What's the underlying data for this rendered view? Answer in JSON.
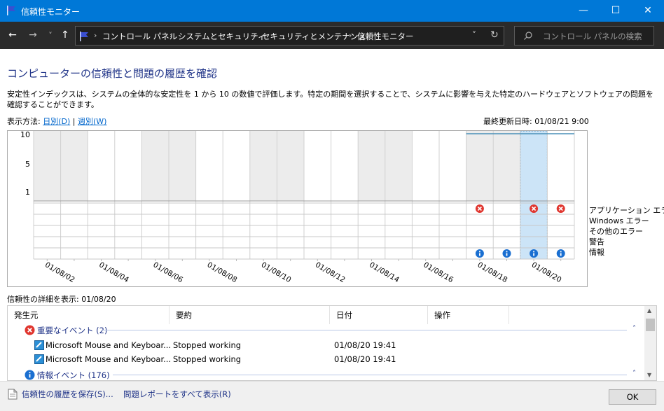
{
  "window": {
    "title": "信頼性モニター",
    "controls": {
      "minimize": "—",
      "maximize": "☐",
      "close": "✕"
    }
  },
  "address_bar": {
    "nav": {
      "back": "←",
      "forward": "→",
      "recent": "˅",
      "up": "↑"
    },
    "breadcrumbs": [
      "コントロール パネル",
      "システムとセキュリティ",
      "セキュリティとメンテナンス",
      "信頼性モニター"
    ],
    "separator": "›",
    "dropdown": "˅",
    "refresh": "↻",
    "search_placeholder": "コントロール パネルの検索"
  },
  "page": {
    "heading": "コンピューターの信頼性と問題の履歴を確認",
    "description": "安定性インデックスは、システムの全体的な安定性を 1 から 10 の数値で評価します。特定の期間を選択することで、システムに影響を与えた特定のハードウェアとソフトウェアの問題を確認することができます。",
    "view_by_label": "表示方法:",
    "view_days": "日別(D)",
    "view_separator": "|",
    "view_weeks": "週別(W)",
    "last_updated": "最終更新日時: 01/08/21 9:00"
  },
  "chart_data": {
    "type": "table",
    "y_axis_labels": [
      "10",
      "5",
      "1"
    ],
    "column_count": 20,
    "date_labels": [
      "01/08/02",
      "01/08/04",
      "01/08/06",
      "01/08/08",
      "01/08/10",
      "01/08/12",
      "01/08/14",
      "01/08/16",
      "01/08/18",
      "01/08/20"
    ],
    "selected_date": "01/08/20",
    "rows": [
      "アプリケーション エラー",
      "Windows エラー",
      "その他のエラー",
      "警告",
      "情報"
    ],
    "stability_index_visible_from_column": 16,
    "stability_index_value": 10,
    "application_error_columns": [
      16,
      18,
      19
    ],
    "information_columns": [
      16,
      17,
      18,
      19
    ],
    "selected_column": 18,
    "error_icon": "error-x-icon",
    "info_icon": "info-i-icon",
    "line_color": "#4a90b8",
    "selected_color": "#cce4f7"
  },
  "details": {
    "label": "信頼性の詳細を表示: 01/08/20",
    "columns": [
      "発生元",
      "要約",
      "日付",
      "操作"
    ],
    "sort_indicator": "^",
    "groups": [
      {
        "title": "重要なイベント (2)",
        "icon": "error-x-icon",
        "collapse": "˄",
        "rows": [
          {
            "source": "Microsoft Mouse and Keyboar...",
            "summary": "Stopped working",
            "date": "01/08/20 19:41",
            "action": ""
          },
          {
            "source": "Microsoft Mouse and Keyboar...",
            "summary": "Stopped working",
            "date": "01/08/20 19:41",
            "action": ""
          }
        ]
      },
      {
        "title": "情報イベント (176)",
        "icon": "info-i-icon",
        "collapse": "˄",
        "rows": []
      }
    ]
  },
  "footer": {
    "save_history": "信頼性の履歴を保存(S)...",
    "view_all_reports": "問題レポートをすべて表示(R)",
    "ok": "OK"
  },
  "colors": {
    "titlebar": "#0078d7",
    "address_bar": "#2b2b2b",
    "heading": "#1e3287",
    "link": "#0066cc",
    "error": "#e0362f",
    "info": "#1a6fd1"
  }
}
